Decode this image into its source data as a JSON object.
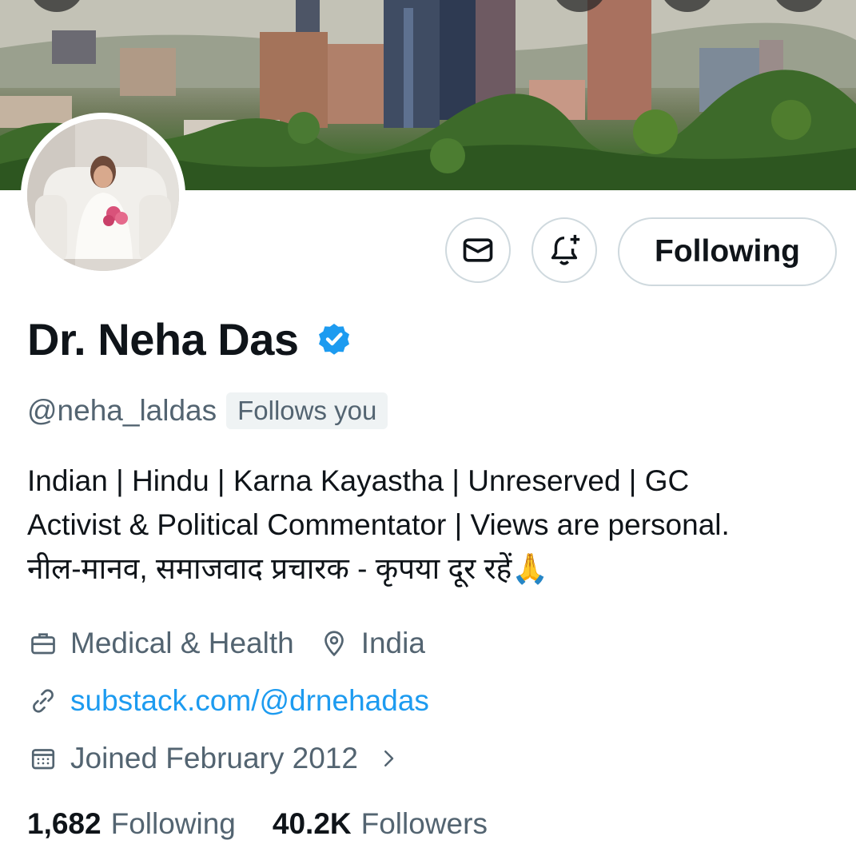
{
  "profile": {
    "display_name": "Dr. Neha Das",
    "handle": "@neha_laldas",
    "follows_you": "Follows you",
    "bio_lines": [
      "Indian | Hindu | Karna Kayastha | Unreserved | GC",
      "Activist & Political Commentator | Views are personal.",
      "नील-मानव, समाजवाद प्रचारक - कृपया दूर रहें🙏"
    ],
    "category": "Medical & Health",
    "location": "India",
    "website": "substack.com/@drnehadas",
    "joined": "Joined February 2012"
  },
  "actions": {
    "message_icon": "envelope-icon",
    "notify_icon": "bell-plus-icon",
    "following_label": "Following"
  },
  "stats": {
    "following_count": "1,682",
    "following_label": "Following",
    "followers_count": "40.2K",
    "followers_label": "Followers"
  },
  "colors": {
    "accent": "#1d9bf0",
    "secondary_text": "#536471",
    "primary_text": "#0f1419",
    "border": "#cfd9de"
  }
}
